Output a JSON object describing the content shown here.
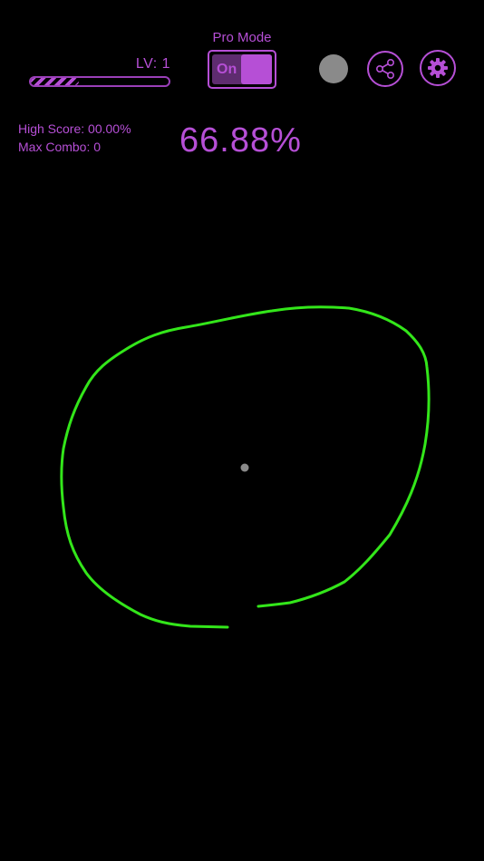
{
  "header": {
    "level_label": "LV: 1",
    "level_progress": 0.35,
    "pro_mode_label": "Pro Mode",
    "pro_mode_toggle_text": "On",
    "pro_mode_on": true
  },
  "stats": {
    "high_score": "High Score: 00.00%",
    "max_combo": "Max Combo: 0",
    "current_score": "66.88%"
  },
  "icons": {
    "status_dot": "gray-circle",
    "share": "share-icon",
    "settings": "gear-icon"
  },
  "colors": {
    "accent": "#b64fd6",
    "background": "#000000",
    "stroke": "#33e61a",
    "center_dot": "#8a8a8a"
  }
}
